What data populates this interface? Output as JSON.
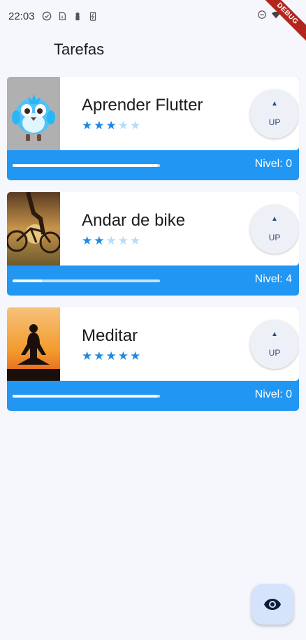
{
  "status_bar": {
    "time": "22:03",
    "debug_label": "DEBUG",
    "icons": [
      "check-circle-icon",
      "sim-card-icon",
      "lock-icon",
      "battery-saver-icon",
      "dnd-icon",
      "wifi-icon",
      "battery-icon"
    ]
  },
  "app_bar": {
    "title": "Tarefas"
  },
  "tasks": [
    {
      "name": "Aprender Flutter",
      "image": "flutter-bird-image",
      "difficulty": 3,
      "max_difficulty": 5,
      "level_label": "Nivel: 0",
      "progress": 0.98,
      "up_label": "UP"
    },
    {
      "name": "Andar de bike",
      "image": "bike-sunset-image",
      "difficulty": 2,
      "max_difficulty": 5,
      "level_label": "Nivel: 4",
      "progress": 0.2,
      "up_label": "UP"
    },
    {
      "name": "Meditar",
      "image": "meditation-sunset-image",
      "difficulty": 5,
      "max_difficulty": 5,
      "level_label": "Nivel: 0",
      "progress": 0.98,
      "up_label": "UP"
    }
  ],
  "fab": {
    "icon": "eye-icon"
  },
  "colors": {
    "primary": "#2196f3",
    "star_on": "#1e88e5",
    "star_off": "#b7dcf8",
    "background": "#f6f7fc"
  }
}
